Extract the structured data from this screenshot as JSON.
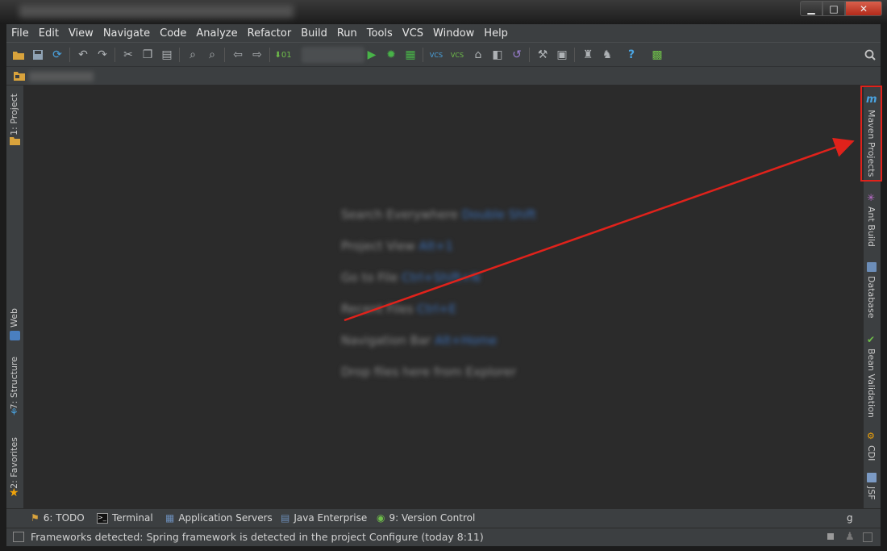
{
  "window": {
    "minimize_glyph": "▁",
    "maximize_glyph": "□",
    "close_glyph": "✕"
  },
  "menu": [
    "File",
    "Edit",
    "View",
    "Navigate",
    "Code",
    "Analyze",
    "Refactor",
    "Build",
    "Run",
    "Tools",
    "VCS",
    "Window",
    "Help"
  ],
  "toolbar_icons": [
    "open-icon",
    "save-icon",
    "sync-icon",
    "undo-icon",
    "redo-icon",
    "cut-icon",
    "copy-icon",
    "paste-icon",
    "find-icon",
    "replace-icon",
    "back-icon",
    "forward-icon",
    "make-icon",
    "run-icon",
    "debug-icon",
    "coverage-icon",
    "vcs-update-icon",
    "vcs-commit-icon",
    "history-icon",
    "annotate-icon",
    "revert-icon",
    "settings-icon",
    "project-structure-icon",
    "sdk-icon",
    "android-icon",
    "help-icon",
    "plugin-icon",
    "search-icon"
  ],
  "left_tabs": {
    "project": "1: Project",
    "web": "Web",
    "structure": "7: Structure",
    "favorites": "2: Favorites"
  },
  "right_tabs": {
    "maven": "Maven Projects",
    "ant": "Ant Build",
    "database": "Database",
    "bean_validation": "Bean Validation",
    "cdi": "CDI",
    "jsf": "JSF"
  },
  "bottom_tabs": {
    "todo": "6: TODO",
    "terminal": "Terminal",
    "app_servers": "Application Servers",
    "java_enterprise": "Java Enterprise",
    "version_control": "9: Version Control",
    "event_log_partial": "g"
  },
  "status": {
    "message": "Frameworks detected: Spring framework is detected in the project Configure (today 8:11)"
  },
  "colors": {
    "accent_red": "#e0221b",
    "background": "#2b2b2b",
    "panel": "#3c3f41"
  }
}
